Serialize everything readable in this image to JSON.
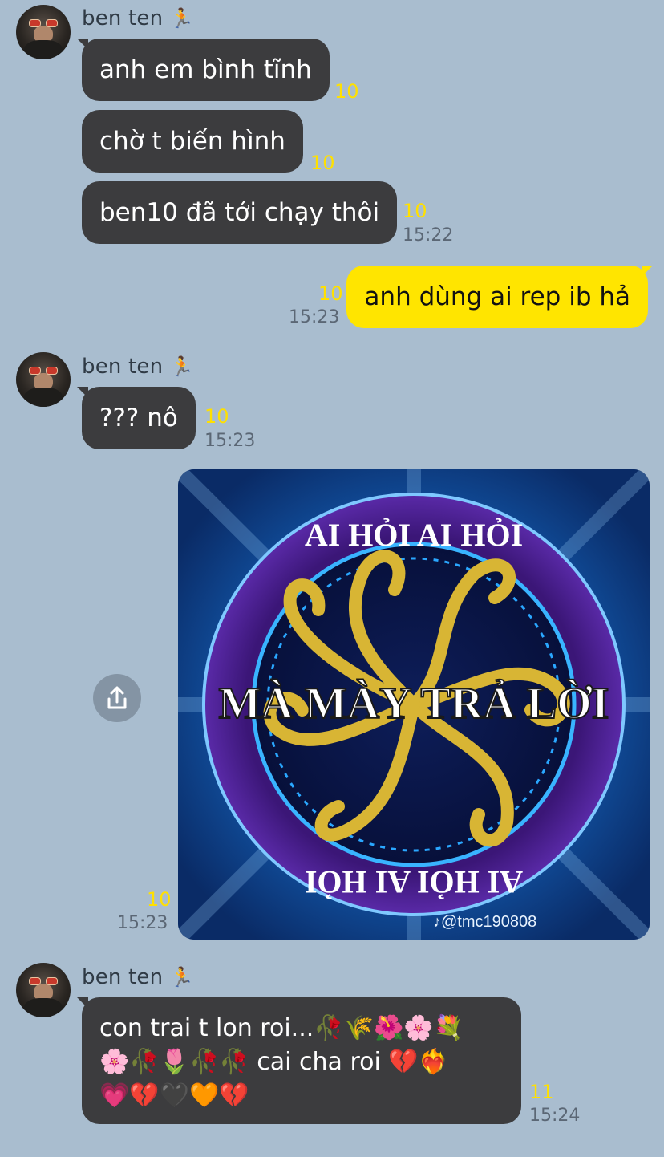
{
  "messages": {
    "group1": {
      "sender": "ben ten",
      "sender_emoji": "🏃",
      "bubbles": [
        {
          "text": "anh em bình tĩnh",
          "unread": "10"
        },
        {
          "text": "chờ t biến hình",
          "unread": "10"
        },
        {
          "text": "ben10 đã tới chạy thôi",
          "unread": "10",
          "time": "15:22"
        }
      ]
    },
    "mine1": {
      "text": "anh dùng ai rep ib hả",
      "unread": "10",
      "time": "15:23"
    },
    "group2": {
      "sender": "ben ten",
      "sender_emoji": "🏃",
      "bubble": {
        "text": "??? nô",
        "unread": "10",
        "time": "15:23"
      }
    },
    "image_msg": {
      "top_text": "AI HỎI AI HỎI",
      "main_text": "MÀ MÀY TRẢ LỜI",
      "bottom_text": "AI HỎI AI HỎI",
      "watermark": "@tmc190808",
      "unread": "10",
      "time": "15:23"
    },
    "group3": {
      "sender": "ben ten",
      "sender_emoji": "🏃",
      "lines": [
        "con trai t lon roi...🥀🌾🌺🌸💐",
        "🌸🥀🌷🥀🥀 cai cha roi 💔❤️‍🔥",
        "💗💔🖤🧡💔"
      ],
      "unread": "11",
      "time": "15:24"
    }
  },
  "icons": {
    "share": "share-icon"
  },
  "colors": {
    "background": "#a9bdcf",
    "incoming_bubble": "#3c3c3e",
    "outgoing_bubble": "#ffe500",
    "unread_count": "#ffe000"
  }
}
